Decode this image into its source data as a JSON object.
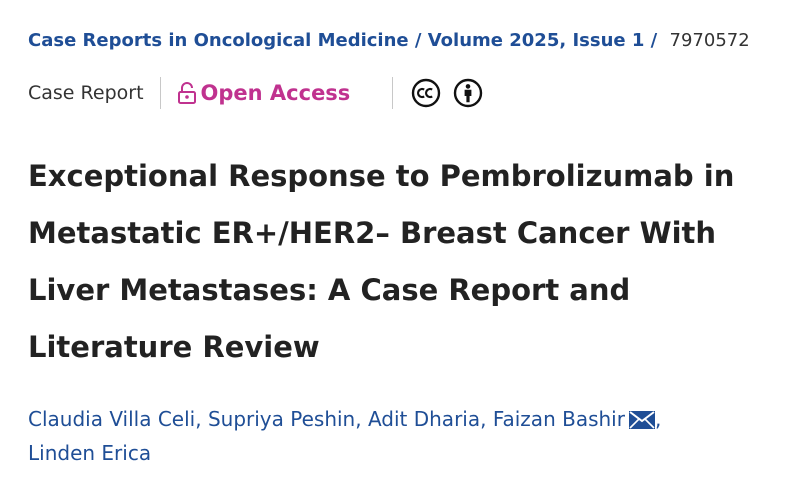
{
  "breadcrumb": {
    "journal": "Case Reports in Oncological Medicine",
    "separator1": " / ",
    "volume": "Volume 2025, Issue 1",
    "separator2": " / ",
    "article_id": "7970572"
  },
  "meta": {
    "article_type": "Case Report",
    "open_access": "Open Access"
  },
  "title": "Exceptional Response to Pembrolizumab in Metastatic ER+/HER2– Breast Cancer With Liver Metastases: A Case Report and Literature Review",
  "authors": [
    "Claudia Villa Celi",
    "Supriya Peshin",
    "Adit Dharia",
    "Faizan Bashir",
    "Linden Erica"
  ],
  "author_separator": ", ",
  "colors": {
    "link": "#1f4e96",
    "open_access": "#c0328f",
    "text": "#222222"
  },
  "icons": [
    "lock-open-icon",
    "creative-commons-icon",
    "attribution-icon",
    "envelope-icon"
  ]
}
